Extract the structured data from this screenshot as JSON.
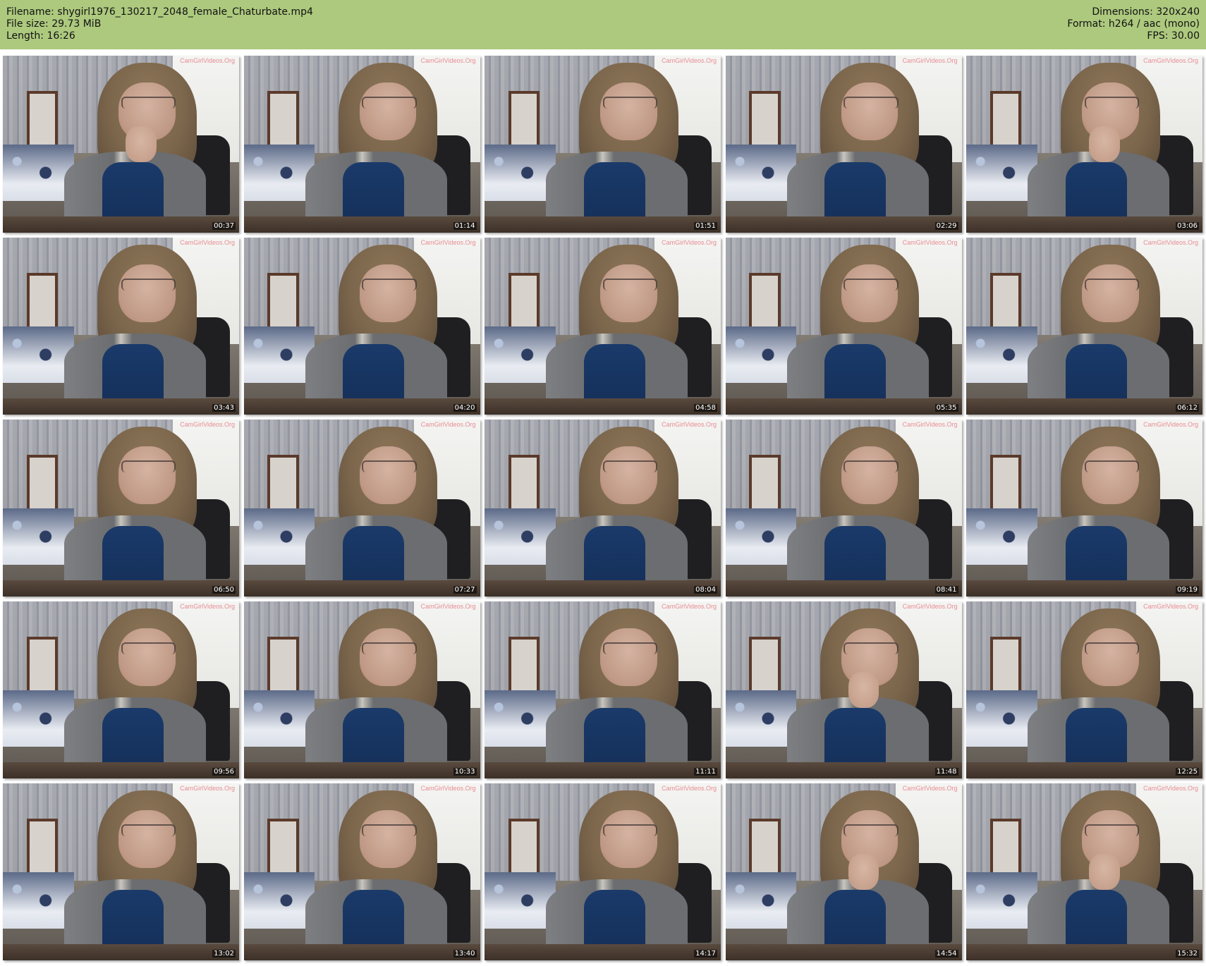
{
  "header": {
    "filename_line": "Filename: shygirl1976_130217_2048_female_Chaturbate.mp4",
    "filesize_line": "File size: 29.73 MiB",
    "length_line": "Length: 16:26",
    "dimensions_line": "Dimensions: 320x240",
    "format_line": "Format: h264 / aac (mono)",
    "fps_line": "FPS: 30.00",
    "background_color": "#adc97e"
  },
  "watermark_text": "CamGirlVideos.Org",
  "thumbnails": [
    {
      "timestamp": "00:37",
      "hand": true
    },
    {
      "timestamp": "01:14",
      "hand": false
    },
    {
      "timestamp": "01:51",
      "hand": false
    },
    {
      "timestamp": "02:29",
      "hand": false
    },
    {
      "timestamp": "03:06",
      "hand": true
    },
    {
      "timestamp": "03:43",
      "hand": false
    },
    {
      "timestamp": "04:20",
      "hand": false
    },
    {
      "timestamp": "04:58",
      "hand": false
    },
    {
      "timestamp": "05:35",
      "hand": false
    },
    {
      "timestamp": "06:12",
      "hand": false
    },
    {
      "timestamp": "06:50",
      "hand": false
    },
    {
      "timestamp": "07:27",
      "hand": false
    },
    {
      "timestamp": "08:04",
      "hand": false
    },
    {
      "timestamp": "08:41",
      "hand": false
    },
    {
      "timestamp": "09:19",
      "hand": false
    },
    {
      "timestamp": "09:56",
      "hand": false
    },
    {
      "timestamp": "10:33",
      "hand": false
    },
    {
      "timestamp": "11:11",
      "hand": false
    },
    {
      "timestamp": "11:48",
      "hand": true
    },
    {
      "timestamp": "12:25",
      "hand": false
    },
    {
      "timestamp": "13:02",
      "hand": false
    },
    {
      "timestamp": "13:40",
      "hand": false
    },
    {
      "timestamp": "14:17",
      "hand": false
    },
    {
      "timestamp": "14:54",
      "hand": true
    },
    {
      "timestamp": "15:32",
      "hand": true
    }
  ]
}
